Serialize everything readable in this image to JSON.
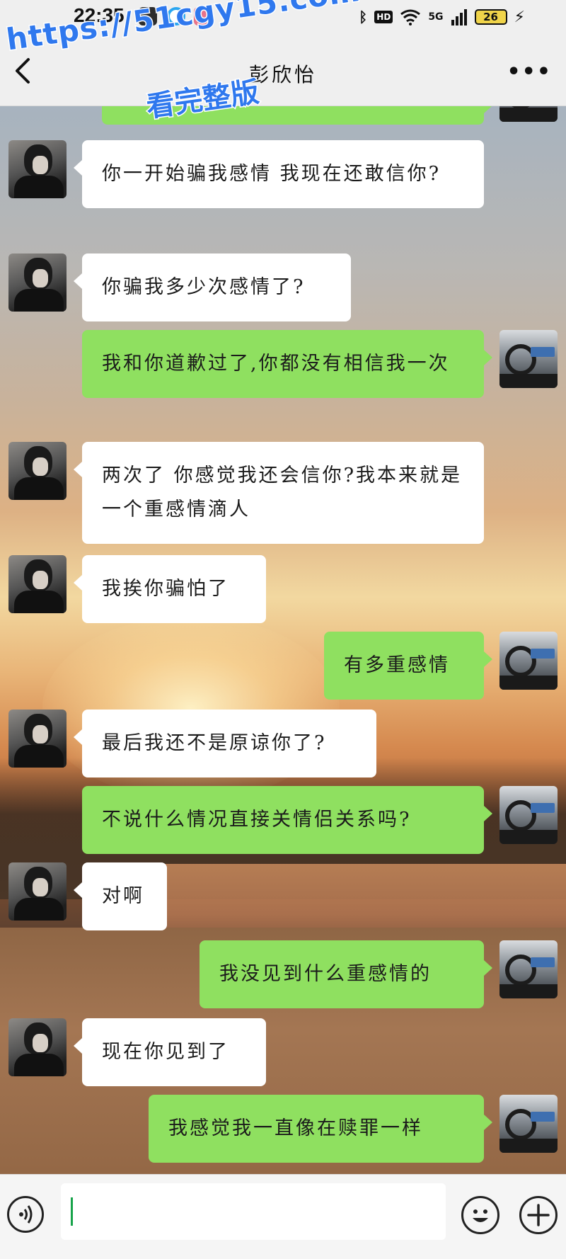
{
  "status_bar": {
    "time": "22:35",
    "network_label": "5G",
    "hd_label": "HD",
    "battery_level": "26"
  },
  "header": {
    "title": "彭欣怡"
  },
  "watermark": {
    "url": "https://51cgy15.com",
    "caption": "看完整版"
  },
  "colors": {
    "sent_bubble": "#8fe060",
    "received_bubble": "#ffffff",
    "watermark": "#2f78ee"
  },
  "messages": [
    {
      "side": "left",
      "text": "你一开始骗我感情 我现在还敢信你?"
    },
    {
      "side": "left",
      "text": "你骗我多少次感情了?"
    },
    {
      "side": "right",
      "text": "我和你道歉过了,你都没有相信我一次"
    },
    {
      "side": "left",
      "text": "两次了 你感觉我还会信你?我本来就是一个重感情滴人"
    },
    {
      "side": "left",
      "text": "我挨你骗怕了"
    },
    {
      "side": "right",
      "text": "有多重感情"
    },
    {
      "side": "left",
      "text": "最后我还不是原谅你了?"
    },
    {
      "side": "right",
      "text": "不说什么情况直接关情侣关系吗?"
    },
    {
      "side": "left",
      "text": "对啊"
    },
    {
      "side": "right",
      "text": "我没见到什么重感情的"
    },
    {
      "side": "left",
      "text": "现在你见到了"
    },
    {
      "side": "right",
      "text": "我感觉我一直像在赎罪一样"
    }
  ],
  "input": {
    "value": ""
  },
  "icons": {
    "back": "chevron-left-icon",
    "more": "more-dots-icon",
    "voice": "voice-icon",
    "emoji": "emoji-icon",
    "add": "plus-icon"
  }
}
